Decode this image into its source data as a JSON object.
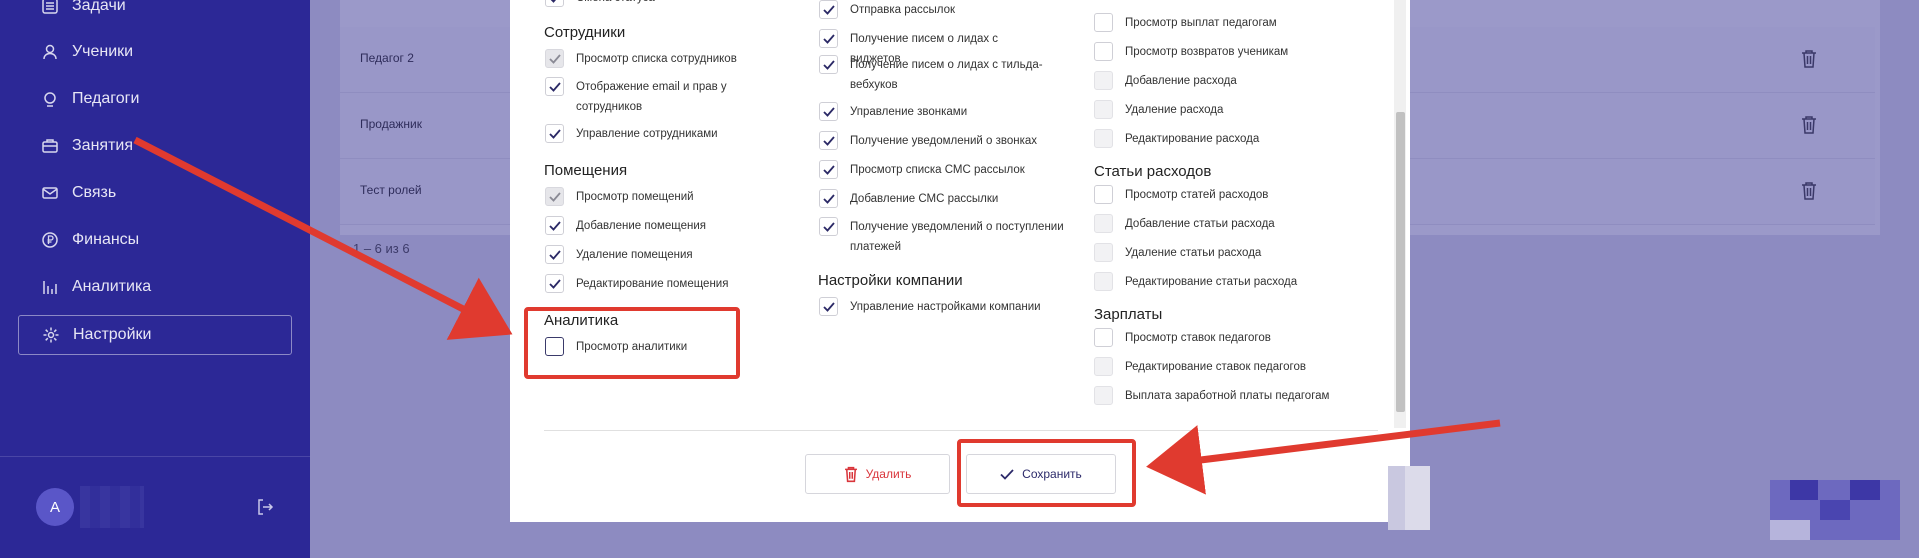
{
  "sidebar": {
    "items": [
      {
        "label": "Задачи",
        "icon": "tasks-icon"
      },
      {
        "label": "Ученики",
        "icon": "user-icon"
      },
      {
        "label": "Педагоги",
        "icon": "teacher-icon"
      },
      {
        "label": "Занятия",
        "icon": "briefcase-icon"
      },
      {
        "label": "Связь",
        "icon": "mail-icon"
      },
      {
        "label": "Финансы",
        "icon": "ruble-icon"
      },
      {
        "label": "Аналитика",
        "icon": "chart-icon"
      },
      {
        "label": "Настройки",
        "icon": "gear-icon"
      }
    ],
    "avatar_letter": "А"
  },
  "background_list": {
    "rows": [
      "Педагог 2",
      "Продажник",
      "Тест ролей"
    ],
    "pager": "1 – 6 из 6"
  },
  "modal": {
    "col1": {
      "top_item": "Смена статуса",
      "sections": [
        {
          "title": "Сотрудники",
          "items": [
            "Просмотр списка сотрудников",
            "Отображение email и прав у сотрудников",
            "Управление сотрудниками"
          ]
        },
        {
          "title": "Помещения",
          "items": [
            "Просмотр помещений",
            "Добавление помещения",
            "Удаление помещения",
            "Редактирование помещения"
          ]
        },
        {
          "title": "Аналитика",
          "items": [
            "Просмотр аналитики"
          ]
        }
      ]
    },
    "col2": {
      "items": [
        "Отправка рассылок",
        "Получение писем о лидах с виджетов",
        "Получение писем о лидах с тильда-вебхуков",
        "Управление звонками",
        "Получение уведомлений о звонках",
        "Просмотр списка СМС рассылок",
        "Добавление СМС рассылки",
        "Получение уведомлений о поступлении платежей"
      ],
      "sections": [
        {
          "title": "Настройки компании",
          "items": [
            "Управление настройками компании"
          ]
        }
      ]
    },
    "col3": {
      "items": [
        "Просмотр выплат педагогам",
        "Просмотр возвратов ученикам",
        "Добавление расхода",
        "Удаление расхода",
        "Редактирование расхода"
      ],
      "sections": [
        {
          "title": "Статьи расходов",
          "items": [
            "Просмотр статей расходов",
            "Добавление статьи расхода",
            "Удаление статьи расхода",
            "Редактирование статьи расхода"
          ]
        },
        {
          "title": "Зарплаты",
          "items": [
            "Просмотр ставок педагогов",
            "Редактирование ставок педагогов",
            "Выплата заработной платы педагогам"
          ]
        }
      ]
    },
    "buttons": {
      "delete": "Удалить",
      "save": "Сохранить"
    }
  },
  "colors": {
    "sidebar": "#2c2896",
    "accent_red": "#e03a2f",
    "delete_red": "#d9353b"
  }
}
